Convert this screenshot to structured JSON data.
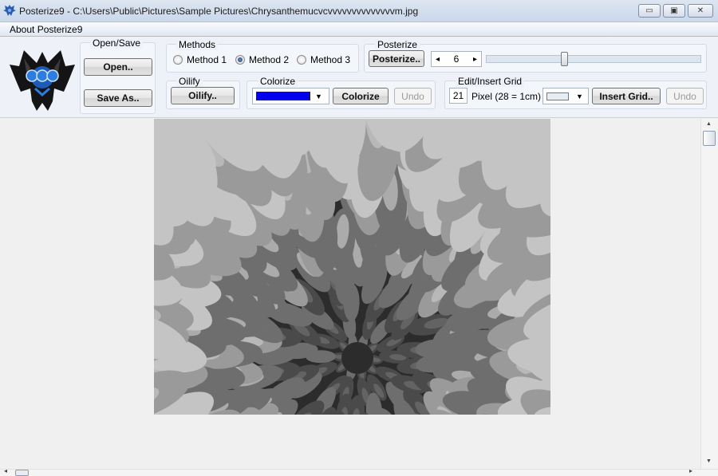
{
  "window": {
    "title": "Posterize9 - C:\\Users\\Public\\Pictures\\Sample Pictures\\Chrysanthemucvcvvvvvvvvvvvvvvm.jpg",
    "minimize_glyph": "▭",
    "maximize_glyph": "▣",
    "close_glyph": "✕"
  },
  "menu": {
    "about": "About Posterize9"
  },
  "open_save": {
    "label": "Open/Save",
    "open": "Open..",
    "save_as": "Save As.."
  },
  "methods": {
    "label": "Methods",
    "options": [
      "Method 1",
      "Method 2",
      "Method 3"
    ],
    "selected": "Method 2"
  },
  "posterize": {
    "label": "Posterize",
    "button": "Posterize..",
    "value": "6",
    "slider_fraction": 0.36
  },
  "oilify": {
    "label": "Oilify",
    "button": "Oilify.."
  },
  "colorize": {
    "label": "Colorize",
    "swatch_color": "#0000ee",
    "button": "Colorize",
    "undo": "Undo"
  },
  "grid": {
    "label": "Edit/Insert Grid",
    "size": "21",
    "unit_text": "Pixel (28 = 1cm)",
    "swatch_color": "#e8edf3",
    "insert_button": "Insert Grid..",
    "undo": "Undo"
  },
  "icons": {
    "app": "eagle-icon",
    "logo": "double-headed-eagle-logo",
    "spin_left": "◂",
    "spin_right": "▸",
    "dropdown": "▼",
    "scroll_up": "▲",
    "scroll_down": "▼",
    "scroll_left": "◂",
    "scroll_right": "▸"
  },
  "image": {
    "background_color": "#2c2c2c",
    "petal_colors": [
      "#4a4a4a",
      "#6e6e6e",
      "#9a9a9a",
      "#c4c4c4"
    ]
  }
}
